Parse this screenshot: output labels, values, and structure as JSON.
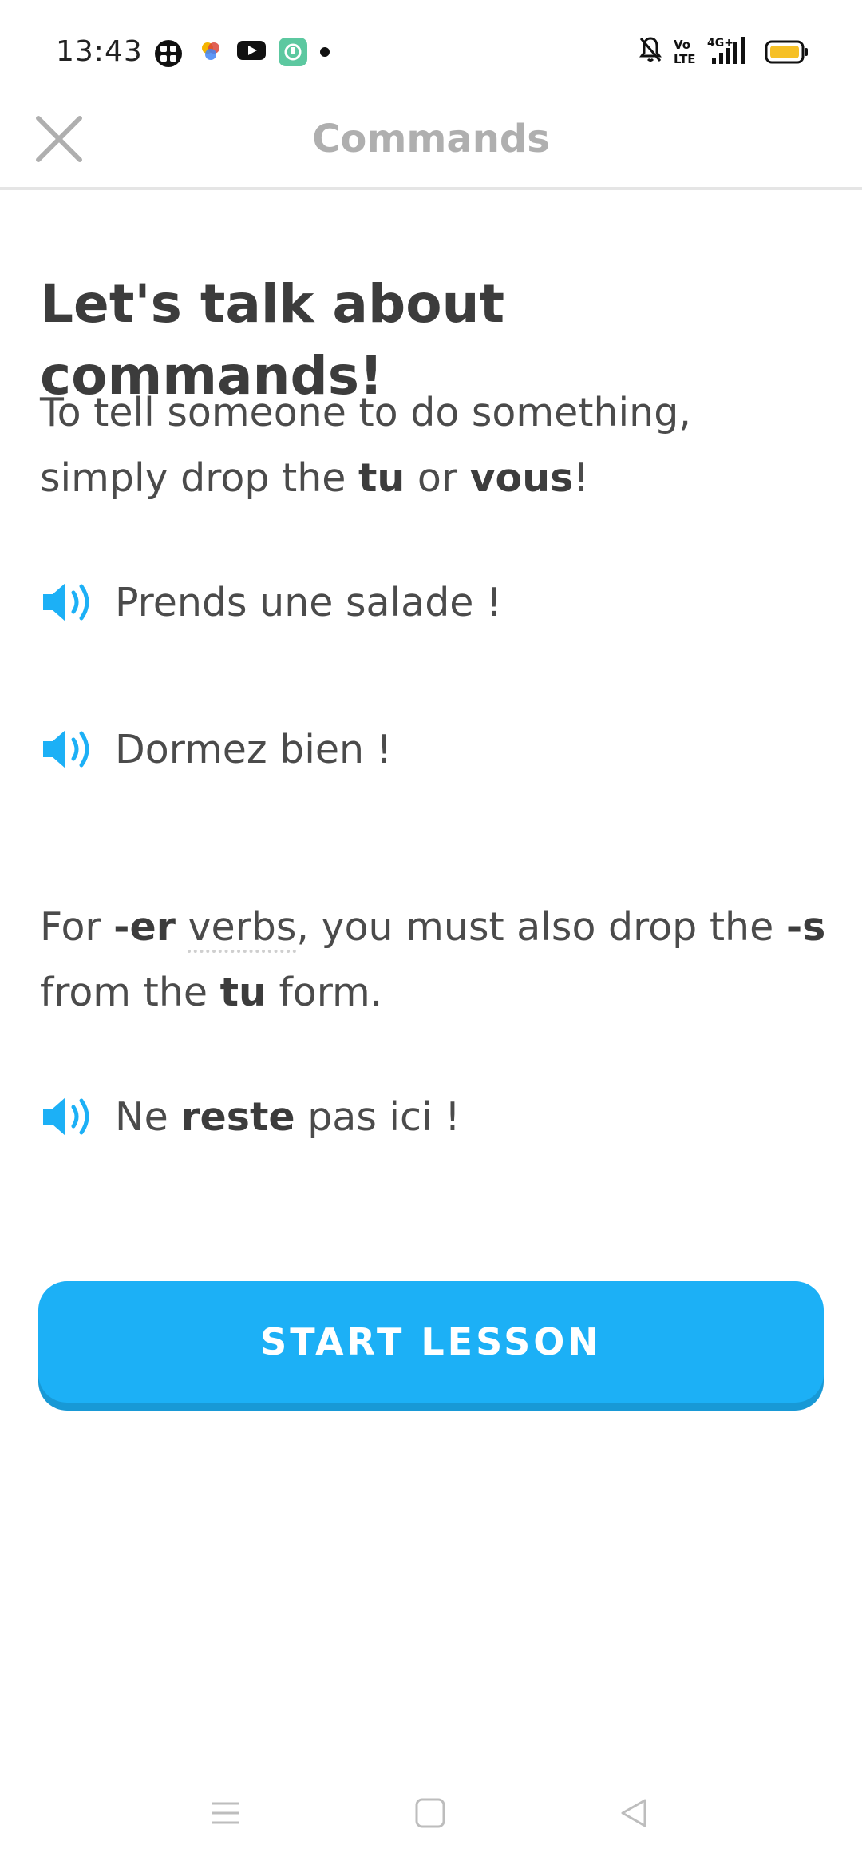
{
  "status_bar": {
    "time": "13:43",
    "icons": [
      "grid-app-icon",
      "pinwheel-icon",
      "youtube-icon",
      "app-badge-icon",
      "dot-icon",
      "mute-icon",
      "volte-icon",
      "signal-4g-icon",
      "battery-icon"
    ]
  },
  "header": {
    "title": "Commands"
  },
  "content": {
    "headline": "Let's talk about commands!",
    "intro": {
      "p1": "To tell someone to do something, simply drop the ",
      "b1": "tu",
      "p2": " or ",
      "b2": "vous",
      "p3": "!"
    },
    "examples": [
      {
        "text": "Prends une salade !"
      },
      {
        "text": "Dormez bien !"
      }
    ],
    "er_rule": {
      "p1": "For ",
      "b1": "-er",
      "p2": " ",
      "link": "verbs",
      "p3": ", you must also drop the ",
      "b2": "-s",
      "p4": " from the ",
      "b3": "tu",
      "p5": " form."
    },
    "er_example": {
      "pre": "Ne ",
      "bold": "reste",
      "post": " pas ici !"
    }
  },
  "button": {
    "label": "START LESSON",
    "color": "#1cb0f6"
  },
  "nav_bar": {
    "icons": [
      "menu-icon",
      "home-icon",
      "back-icon"
    ]
  }
}
